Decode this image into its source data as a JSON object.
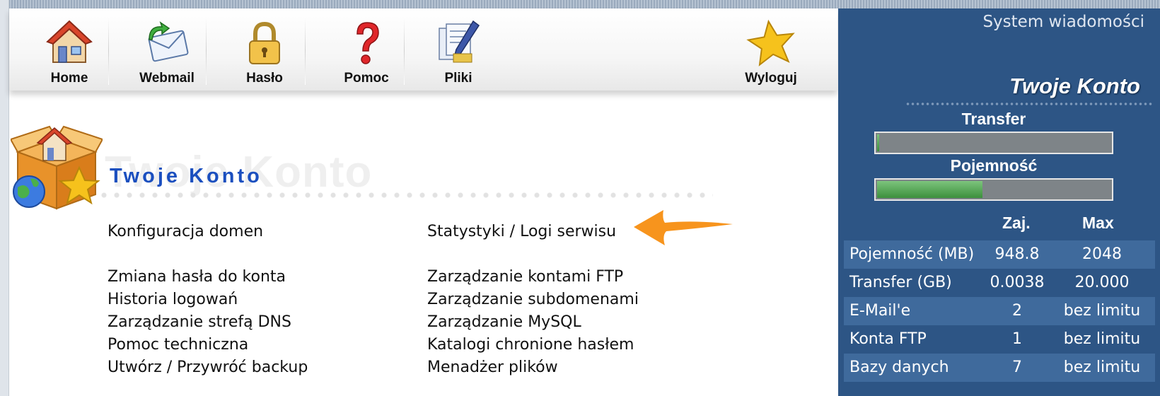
{
  "toolbar": {
    "items": [
      {
        "label": "Home",
        "icon": "house-icon"
      },
      {
        "label": "Webmail",
        "icon": "envelope-icon"
      },
      {
        "label": "Hasło",
        "icon": "padlock-icon"
      },
      {
        "label": "Pomoc",
        "icon": "question-mark-icon"
      },
      {
        "label": "Pliki",
        "icon": "documents-pen-icon"
      },
      {
        "label": "Wyloguj",
        "icon": "star-icon"
      }
    ]
  },
  "header": {
    "logo_title": "Twoje Konto",
    "logo_ghost": "Twoje Konto"
  },
  "menu": {
    "left": [
      "Konfiguracja domen",
      "Zmiana hasła do konta",
      "Historia logowań",
      "Zarządzanie strefą DNS",
      "Pomoc techniczna",
      "Utwórz / Przywróć backup"
    ],
    "right": [
      "Statystyki / Logi serwisu",
      "Zarządzanie kontami FTP",
      "Zarządzanie subdomenami",
      "Zarządzanie MySQL",
      "Katalogi chronione hasłem",
      "Menadżer plików"
    ]
  },
  "panel": {
    "system_messages": "System wiadomości",
    "title": "Twoje Konto",
    "transfer_label": "Transfer",
    "transfer_fill": 0.01,
    "capacity_label": "Pojemność",
    "capacity_fill": 0.45,
    "col_used": "Zaj.",
    "col_max": "Max",
    "rows": [
      {
        "name": "Pojemność (MB)",
        "used": "948.8",
        "max": "2048"
      },
      {
        "name": "Transfer (GB)",
        "used": "0.0038",
        "max": "20.000"
      },
      {
        "name": "E-Mail'e",
        "used": "2",
        "max": "bez limitu"
      },
      {
        "name": "Konta FTP",
        "used": "1",
        "max": "bez limitu"
      },
      {
        "name": "Bazy danych",
        "used": "7",
        "max": "bez limitu"
      }
    ]
  },
  "colors": {
    "panel_bg": "#2d5585",
    "logo_title": "#1b4fbf",
    "arrow": "#f7941d",
    "bar_fill": "#4aa04a"
  }
}
